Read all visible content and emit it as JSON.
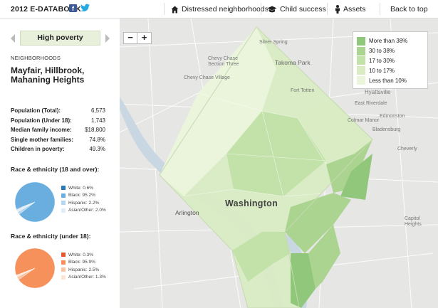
{
  "header": {
    "brand": "2012 E-DATABOOK",
    "facebook_glyph": "f",
    "nav": [
      {
        "label": "Distressed neighborhoods",
        "icon": "house-icon"
      },
      {
        "label": "Child success",
        "icon": "graduation-cap-icon"
      },
      {
        "label": "Assets",
        "icon": "person-icon"
      },
      {
        "label": "Back to top",
        "icon": ""
      }
    ]
  },
  "sidebar": {
    "selector_label": "High poverty",
    "section_label": "NEIGHBORHOODS",
    "neighborhood": "Mayfair, Hillbrook, Mahaning Heights",
    "stats": [
      {
        "label": "Population (Total):",
        "value": "6,573"
      },
      {
        "label": "Population (Under 18):",
        "value": "1,743"
      },
      {
        "label": "Median family income:",
        "value": "$18,800"
      },
      {
        "label": "Single mother families:",
        "value": "74.8%"
      },
      {
        "label": "Children in poverty:",
        "value": "49.3%"
      }
    ],
    "race_adult": {
      "title": "Race & ethnicity (18 and over):",
      "color": "#6aaee0",
      "legend": [
        {
          "label": "White: 0.6%",
          "color": "#2f78b8",
          "value": 0.6
        },
        {
          "label": "Black: 95.2%",
          "color": "#6aaee0",
          "value": 95.2
        },
        {
          "label": "Hispanic: 2.2%",
          "color": "#b5d6ee",
          "value": 2.2
        },
        {
          "label": "Asian/Other: 2.0%",
          "color": "#e1edf7",
          "value": 2.0
        }
      ]
    },
    "race_child": {
      "title": "Race & ethnicity (under 18):",
      "color": "#f7915c",
      "legend": [
        {
          "label": "White: 0.3%",
          "color": "#e4572e",
          "value": 0.3
        },
        {
          "label": "Black: 95.9%",
          "color": "#f7915c",
          "value": 95.9
        },
        {
          "label": "Hispanic: 2.5%",
          "color": "#f9c5a4",
          "value": 2.5
        },
        {
          "label": "Asian/Other: 1.3%",
          "color": "#fde5d6",
          "value": 1.3
        }
      ]
    }
  },
  "map": {
    "zoom_out": "−",
    "zoom_in": "+",
    "legend": [
      {
        "label": "More than 38%",
        "color": "#90c77a"
      },
      {
        "label": "30 to 38%",
        "color": "#aad48f"
      },
      {
        "label": "17 to 30%",
        "color": "#c3e2aa"
      },
      {
        "label": "10 to 17%",
        "color": "#d9ecc4"
      },
      {
        "label": "Less than 10%",
        "color": "#eaf5dc"
      }
    ],
    "city_label": "Washington",
    "place_labels": [
      "Chevy Chase Section Three",
      "Chevy Chase Village",
      "Takoma Park",
      "Hyattsville",
      "Edmonston",
      "Bladensburg",
      "Cheverly",
      "Arlington",
      "Capitol Heights",
      "East Riverdale",
      "Colmar Manor",
      "Fort Totten",
      "Silver Spring"
    ]
  }
}
